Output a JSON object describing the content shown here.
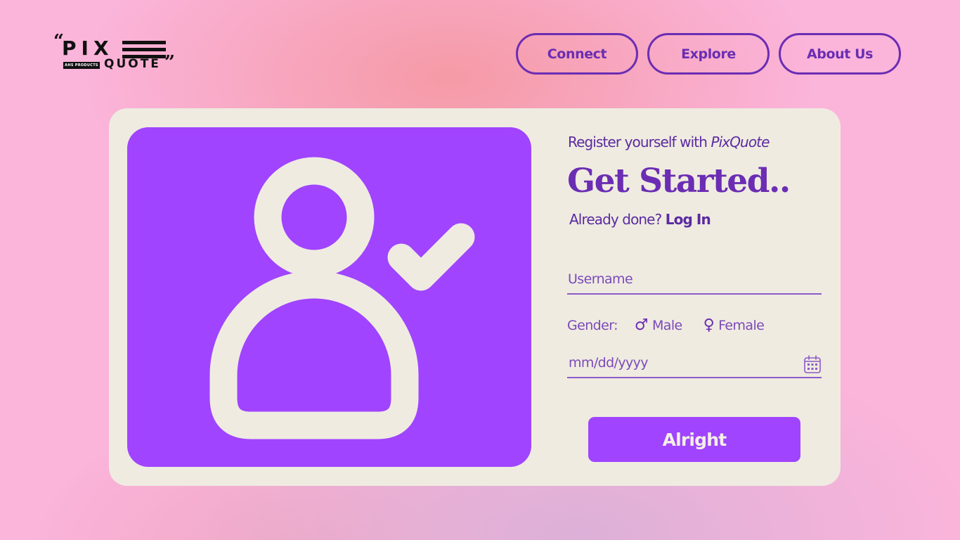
{
  "logo": {
    "quote_open": "“",
    "pix": "PIX",
    "tagline": "AHS PRODUCTS",
    "quote_word": "QUOTE",
    "quote_close": "”"
  },
  "nav": {
    "items": [
      {
        "label": "Connect"
      },
      {
        "label": "Explore"
      },
      {
        "label": "About Us"
      }
    ]
  },
  "card": {
    "subtitle_prefix": "Register yourself with ",
    "subtitle_brand": "PixQuote",
    "title": "Get Started..",
    "login_prompt": "Already done? ",
    "login_link": "Log In"
  },
  "form": {
    "username_placeholder": "Username",
    "gender_label": "Gender:",
    "gender_options": [
      {
        "symbol": "♂",
        "label": "Male"
      },
      {
        "symbol": "♀",
        "label": "Female"
      }
    ],
    "date_placeholder": "mm/dd/yyyy",
    "submit_label": "Alright"
  },
  "icons": {
    "illustration": "user-check-icon",
    "date_picker": "calendar-icon"
  },
  "colors": {
    "background_pink": "#fbb4da",
    "accent_purple": "#a044ff",
    "text_purple": "#6b2db3",
    "card_cream": "#efebe1"
  }
}
